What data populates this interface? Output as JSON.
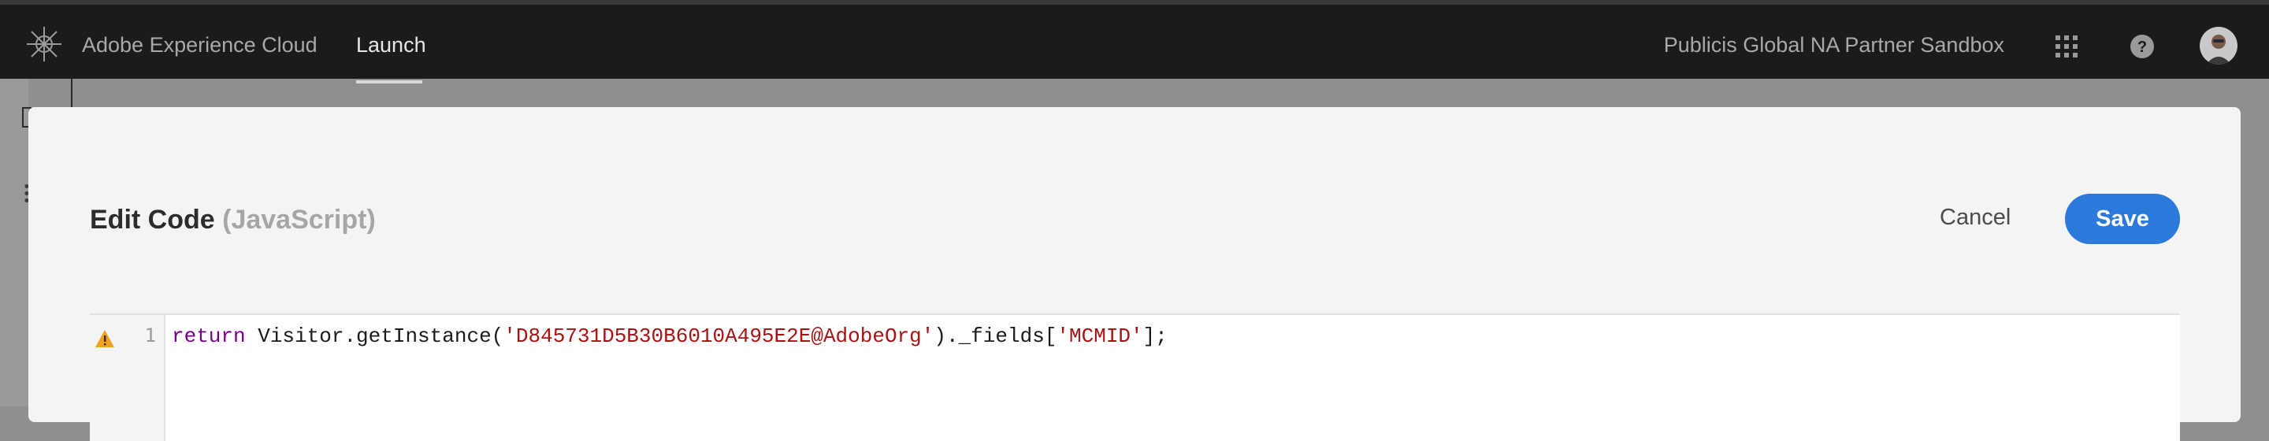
{
  "header": {
    "brand": "Adobe Experience Cloud",
    "active_tab": "Launch",
    "org_name": "Publicis Global NA Partner Sandbox",
    "icons": [
      "adobe-logo-icon",
      "apps-grid-icon",
      "help-icon",
      "avatar"
    ]
  },
  "dialog": {
    "title": "Edit Code",
    "language": "(JavaScript)",
    "cancel_label": "Cancel",
    "save_label": "Save"
  },
  "editor": {
    "line_number": "1",
    "code": {
      "keyword": "return",
      "call_prefix": " Visitor.getInstance(",
      "org_id": "'D845731D5B30B6010A495E2E@AdobeOrg'",
      "fields_part": ")._fields[",
      "field_key": "'MCMID'",
      "end": "];"
    },
    "warning_icon": "warning-icon"
  },
  "colors": {
    "header_bg": "#1b1b1b",
    "accent_blue": "#2c79dc",
    "keyword": "#770088",
    "string": "#aa1111",
    "warning": "#f2a01f"
  }
}
